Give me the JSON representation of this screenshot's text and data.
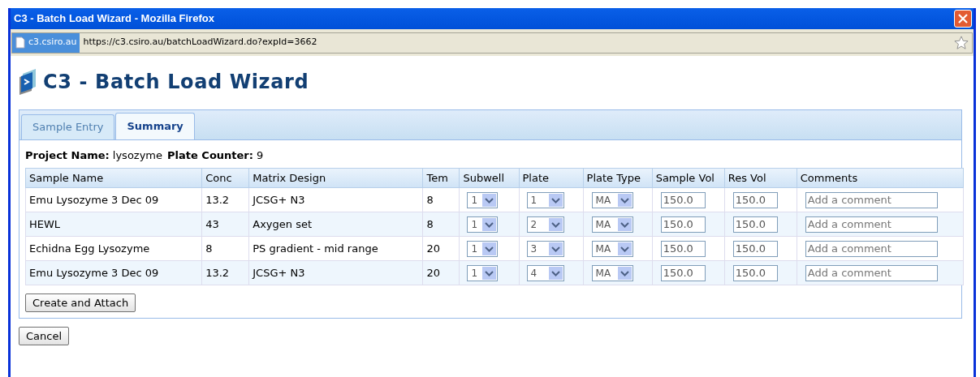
{
  "window": {
    "title": "C3 - Batch Load Wizard - Mozilla Firefox"
  },
  "address_bar": {
    "site": "c3.csiro.au",
    "url": "https://c3.csiro.au/batchLoadWizard.do?expId=3662"
  },
  "page_title": "C3 - Batch Load Wizard",
  "tabs": [
    {
      "label": "Sample Entry",
      "selected": false
    },
    {
      "label": "Summary",
      "selected": true
    }
  ],
  "info": [
    {
      "label": "Project Name:",
      "value": "lysozyme"
    },
    {
      "label": "Plate Counter:",
      "value": "9"
    }
  ],
  "table": {
    "columns": [
      "Sample Name",
      "Conc",
      "Matrix Design",
      "Tem",
      "Subwell",
      "Plate",
      "Plate Type",
      "Sample Vol",
      "Res Vol",
      "Comments"
    ],
    "rows": [
      {
        "sample_name": "Emu Lysozyme 3 Dec 09",
        "conc": "13.2",
        "matrix_design": "JCSG+ N3",
        "temp": "8",
        "subwell": "1",
        "plate": "1",
        "plate_type": "MA",
        "sample_vol": "150.0",
        "res_vol": "150.0",
        "comment_placeholder": "Add a comment"
      },
      {
        "sample_name": "HEWL",
        "conc": "43",
        "matrix_design": "Axygen set",
        "temp": "8",
        "subwell": "1",
        "plate": "2",
        "plate_type": "MA",
        "sample_vol": "150.0",
        "res_vol": "150.0",
        "comment_placeholder": "Add a comment"
      },
      {
        "sample_name": "Echidna Egg Lysozyme",
        "conc": "8",
        "matrix_design": "PS gradient - mid range",
        "temp": "20",
        "subwell": "1",
        "plate": "3",
        "plate_type": "MA",
        "sample_vol": "150.0",
        "res_vol": "150.0",
        "comment_placeholder": "Add a comment"
      },
      {
        "sample_name": "Emu Lysozyme 3 Dec 09",
        "conc": "13.2",
        "matrix_design": "JCSG+ N3",
        "temp": "20",
        "subwell": "1",
        "plate": "4",
        "plate_type": "MA",
        "sample_vol": "150.0",
        "res_vol": "150.0",
        "comment_placeholder": "Add a comment"
      }
    ]
  },
  "panel_button": "Create and Attach",
  "cancel_button": "Cancel"
}
